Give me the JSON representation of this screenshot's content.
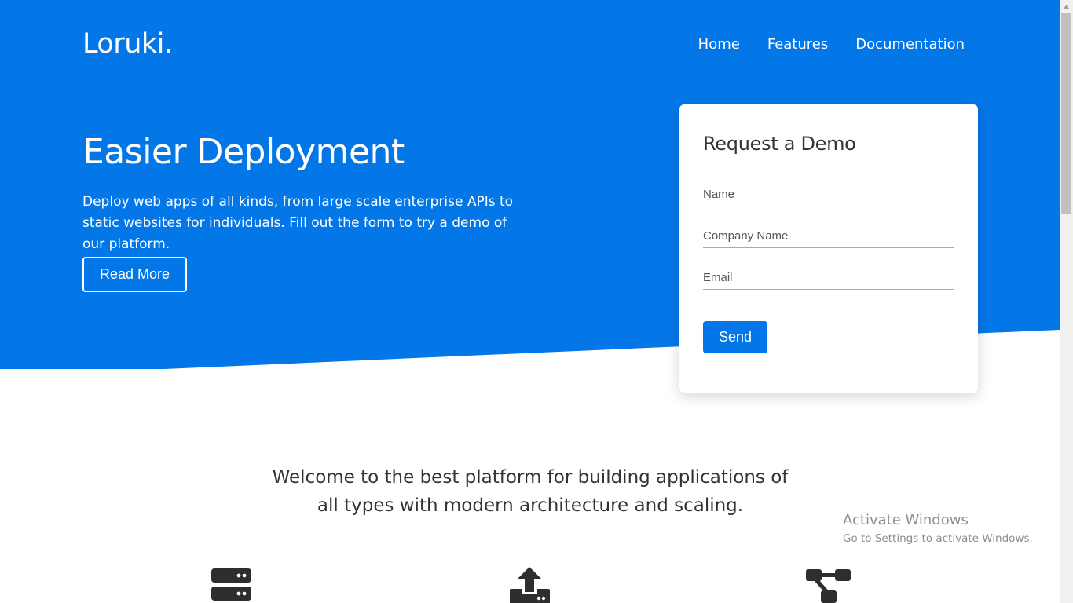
{
  "colors": {
    "brand_blue": "#0477e8",
    "white": "#ffffff",
    "text_dark": "#333333",
    "icon_dark": "#2e2e2e"
  },
  "header": {
    "logo": "Loruki.",
    "nav": [
      {
        "label": "Home"
      },
      {
        "label": "Features"
      },
      {
        "label": "Documentation"
      }
    ]
  },
  "hero": {
    "title": "Easier Deployment",
    "description": "Deploy web apps of all kinds, from large scale enterprise APIs to static websites for individuals. Fill out the form to try a demo of our platform.",
    "cta_label": "Read More"
  },
  "form": {
    "title": "Request a Demo",
    "fields": {
      "name_placeholder": "Name",
      "company_placeholder": "Company Name",
      "email_placeholder": "Email"
    },
    "submit_label": "Send"
  },
  "welcome_text": "Welcome to the best platform for building applications of all types with modern architecture and scaling.",
  "features": [
    {
      "icon": "server-icon"
    },
    {
      "icon": "upload-icon"
    },
    {
      "icon": "network-icon"
    }
  ],
  "watermark": {
    "title": "Activate Windows",
    "subtitle": "Go to Settings to activate Windows."
  }
}
